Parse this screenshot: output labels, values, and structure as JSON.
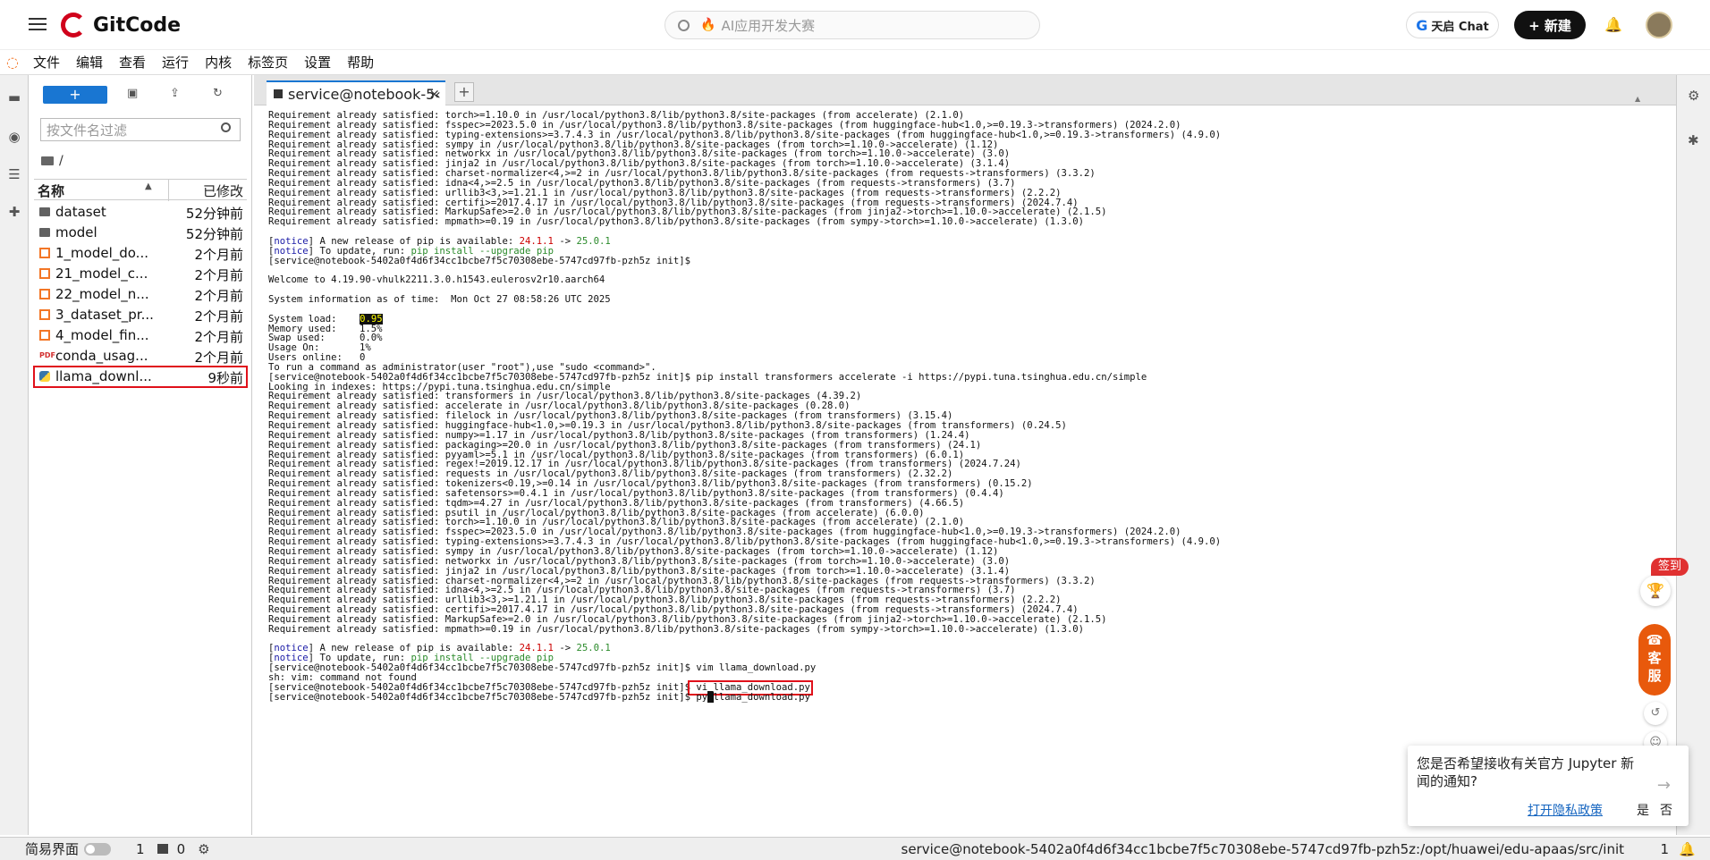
{
  "topbar": {
    "brand": "GitCode",
    "search_placeholder": "AI应用开发大赛",
    "chat_label": "天启 Chat",
    "chat_icon": "G",
    "new_label": "+ 新建"
  },
  "menu": [
    "文件",
    "编辑",
    "查看",
    "运行",
    "内核",
    "标签页",
    "设置",
    "帮助"
  ],
  "filebrowser": {
    "new_label": "+",
    "filter_placeholder": "按文件名过滤",
    "breadcrumb": "/",
    "col_name": "名称",
    "col_modified": "已修改",
    "files": [
      {
        "name": "dataset",
        "modified": "52分钟前",
        "type": "folder"
      },
      {
        "name": "model",
        "modified": "52分钟前",
        "type": "folder"
      },
      {
        "name": "1_model_do...",
        "modified": "2个月前",
        "type": "notebook"
      },
      {
        "name": "21_model_c...",
        "modified": "2个月前",
        "type": "notebook"
      },
      {
        "name": "22_model_n...",
        "modified": "2个月前",
        "type": "notebook"
      },
      {
        "name": "3_dataset_pr...",
        "modified": "2个月前",
        "type": "notebook"
      },
      {
        "name": "4_model_fin...",
        "modified": "2个月前",
        "type": "notebook"
      },
      {
        "name": "conda_usag...",
        "modified": "2个月前",
        "type": "pdf"
      },
      {
        "name": "llama_downl...",
        "modified": "9秒前",
        "type": "python"
      }
    ]
  },
  "tab": {
    "label": "service@notebook-5‹"
  },
  "terminal": {
    "block1": [
      "Requirement already satisfied: torch>=1.10.0 in /usr/local/python3.8/lib/python3.8/site-packages (from accelerate) (2.1.0)",
      "Requirement already satisfied: fsspec>=2023.5.0 in /usr/local/python3.8/lib/python3.8/site-packages (from huggingface-hub<1.0,>=0.19.3->transformers) (2024.2.0)",
      "Requirement already satisfied: typing-extensions>=3.7.4.3 in /usr/local/python3.8/lib/python3.8/site-packages (from huggingface-hub<1.0,>=0.19.3->transformers) (4.9.0)",
      "Requirement already satisfied: sympy in /usr/local/python3.8/lib/python3.8/site-packages (from torch>=1.10.0->accelerate) (1.12)",
      "Requirement already satisfied: networkx in /usr/local/python3.8/lib/python3.8/site-packages (from torch>=1.10.0->accelerate) (3.0)",
      "Requirement already satisfied: jinja2 in /usr/local/python3.8/lib/python3.8/site-packages (from torch>=1.10.0->accelerate) (3.1.4)",
      "Requirement already satisfied: charset-normalizer<4,>=2 in /usr/local/python3.8/lib/python3.8/site-packages (from requests->transformers) (3.3.2)",
      "Requirement already satisfied: idna<4,>=2.5 in /usr/local/python3.8/lib/python3.8/site-packages (from requests->transformers) (3.7)",
      "Requirement already satisfied: urllib3<3,>=1.21.1 in /usr/local/python3.8/lib/python3.8/site-packages (from requests->transformers) (2.2.2)",
      "Requirement already satisfied: certifi>=2017.4.17 in /usr/local/python3.8/lib/python3.8/site-packages (from requests->transformers) (2024.7.4)",
      "Requirement already satisfied: MarkupSafe>=2.0 in /usr/local/python3.8/lib/python3.8/site-packages (from jinja2->torch>=1.10.0->accelerate) (2.1.5)",
      "Requirement already satisfied: mpmath>=0.19 in /usr/local/python3.8/lib/python3.8/site-packages (from sympy->torch>=1.10.0->accelerate) (1.3.0)"
    ],
    "notice_tag": "notice",
    "notice1_pre": "A new release of pip is available: ",
    "notice_old": "24.1.1",
    "notice_arrow": " -> ",
    "notice_new": "25.0.1",
    "notice2_pre": "To update, run: ",
    "notice2_cmd": "pip install --upgrade pip",
    "prompt": "[service@notebook-5402a0f4d6f34cc1bcbe7f5c70308ebe-5747cd97fb-pzh5z init]$",
    "welcome": "Welcome to 4.19.90-vhulk2211.3.0.h1543.eulerosv2r10.aarch64",
    "sysinfo": "System information as of time:  Mon Oct 27 08:58:26 UTC 2025",
    "sysload_label": "System load:    ",
    "sysload_value": "0.95",
    "stats": [
      "Memory used:    1.5%",
      "Swap used:      0.0%",
      "Usage On:       1%",
      "Users online:   0"
    ],
    "admin_hint": "To run a command as administrator(user \"root\"),use \"sudo <command>\".",
    "pip_cmd": " pip install transformers accelerate -i https://pypi.tuna.tsinghua.edu.cn/simple",
    "looking": "Looking in indexes: https://pypi.tuna.tsinghua.edu.cn/simple",
    "block2": [
      "Requirement already satisfied: transformers in /usr/local/python3.8/lib/python3.8/site-packages (4.39.2)",
      "Requirement already satisfied: accelerate in /usr/local/python3.8/lib/python3.8/site-packages (0.28.0)",
      "Requirement already satisfied: filelock in /usr/local/python3.8/lib/python3.8/site-packages (from transformers) (3.15.4)",
      "Requirement already satisfied: huggingface-hub<1.0,>=0.19.3 in /usr/local/python3.8/lib/python3.8/site-packages (from transformers) (0.24.5)",
      "Requirement already satisfied: numpy>=1.17 in /usr/local/python3.8/lib/python3.8/site-packages (from transformers) (1.24.4)",
      "Requirement already satisfied: packaging>=20.0 in /usr/local/python3.8/lib/python3.8/site-packages (from transformers) (24.1)",
      "Requirement already satisfied: pyyaml>=5.1 in /usr/local/python3.8/lib/python3.8/site-packages (from transformers) (6.0.1)",
      "Requirement already satisfied: regex!=2019.12.17 in /usr/local/python3.8/lib/python3.8/site-packages (from transformers) (2024.7.24)",
      "Requirement already satisfied: requests in /usr/local/python3.8/lib/python3.8/site-packages (from transformers) (2.32.2)",
      "Requirement already satisfied: tokenizers<0.19,>=0.14 in /usr/local/python3.8/lib/python3.8/site-packages (from transformers) (0.15.2)",
      "Requirement already satisfied: safetensors>=0.4.1 in /usr/local/python3.8/lib/python3.8/site-packages (from transformers) (0.4.4)",
      "Requirement already satisfied: tqdm>=4.27 in /usr/local/python3.8/lib/python3.8/site-packages (from transformers) (4.66.5)",
      "Requirement already satisfied: psutil in /usr/local/python3.8/lib/python3.8/site-packages (from accelerate) (6.0.0)",
      "Requirement already satisfied: torch>=1.10.0 in /usr/local/python3.8/lib/python3.8/site-packages (from accelerate) (2.1.0)",
      "Requirement already satisfied: fsspec>=2023.5.0 in /usr/local/python3.8/lib/python3.8/site-packages (from huggingface-hub<1.0,>=0.19.3->transformers) (2024.2.0)",
      "Requirement already satisfied: typing-extensions>=3.7.4.3 in /usr/local/python3.8/lib/python3.8/site-packages (from huggingface-hub<1.0,>=0.19.3->transformers) (4.9.0)",
      "Requirement already satisfied: sympy in /usr/local/python3.8/lib/python3.8/site-packages (from torch>=1.10.0->accelerate) (1.12)",
      "Requirement already satisfied: networkx in /usr/local/python3.8/lib/python3.8/site-packages (from torch>=1.10.0->accelerate) (3.0)",
      "Requirement already satisfied: jinja2 in /usr/local/python3.8/lib/python3.8/site-packages (from torch>=1.10.0->accelerate) (3.1.4)",
      "Requirement already satisfied: charset-normalizer<4,>=2 in /usr/local/python3.8/lib/python3.8/site-packages (from requests->transformers) (3.3.2)",
      "Requirement already satisfied: idna<4,>=2.5 in /usr/local/python3.8/lib/python3.8/site-packages (from requests->transformers) (3.7)",
      "Requirement already satisfied: urllib3<3,>=1.21.1 in /usr/local/python3.8/lib/python3.8/site-packages (from requests->transformers) (2.2.2)",
      "Requirement already satisfied: certifi>=2017.4.17 in /usr/local/python3.8/lib/python3.8/site-packages (from requests->transformers) (2024.7.4)",
      "Requirement already satisfied: MarkupSafe>=2.0 in /usr/local/python3.8/lib/python3.8/site-packages (from jinja2->torch>=1.10.0->accelerate) (2.1.5)",
      "Requirement already satisfied: mpmath>=0.19 in /usr/local/python3.8/lib/python3.8/site-packages (from sympy->torch>=1.10.0->accelerate) (1.3.0)"
    ],
    "vim_cmd": " vim llama_download.py",
    "vim_err": "sh: vim: command not found",
    "vi_cmd": " vi llama_download.py",
    "py_pre": " py",
    "py_post": "llama_download.py"
  },
  "floating": {
    "sign": "签到",
    "kefu_1": "客",
    "kefu_2": "服"
  },
  "notification": {
    "message": "您是否希望接收有关官方 Jupyter 新闻的通知?",
    "link": "打开隐私政策",
    "yes": "是",
    "no": "否"
  },
  "status": {
    "simple": "简易界面",
    "kernels": "1",
    "terminals": "0",
    "path": "service@notebook-5402a0f4d6f34cc1bcbe7f5c70308ebe-5747cd97fb-pzh5z:/opt/huawei/edu-apaas/src/init",
    "count": "1"
  },
  "colors": {
    "accent": "#1976d2",
    "highlight": "#e0101a",
    "brand": "#d0021b"
  }
}
